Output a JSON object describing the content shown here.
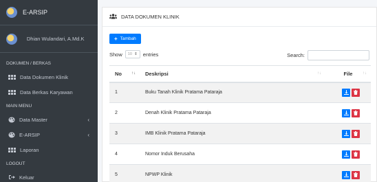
{
  "brand": {
    "title": "E-ARSIP"
  },
  "user": {
    "name": "Dhian Wulandari, A.Md.K"
  },
  "sidebar": {
    "sections": [
      {
        "header": "DOKUMEN / BERKAS"
      },
      {
        "header": "MAIN MENU"
      },
      {
        "header": "LOGOUT"
      }
    ],
    "items": [
      {
        "label": "Data Dokumen Klinik",
        "icon": "table-icon"
      },
      {
        "label": "Data Berkas Karyawan",
        "icon": "table-icon"
      },
      {
        "label": "Data Master",
        "icon": "palette-icon"
      },
      {
        "label": "E-ARSIP",
        "icon": "palette-icon"
      },
      {
        "label": "Laporan",
        "icon": "table-icon"
      },
      {
        "label": "Keluar",
        "icon": "sign-out-icon"
      }
    ]
  },
  "card": {
    "title": "DATA DOKUMEN KLINIK",
    "add_label": "Tambah"
  },
  "controls": {
    "show_label": "Show",
    "show_value": "10",
    "entries_label": "entries",
    "search_label": "Search:"
  },
  "table": {
    "headers": [
      "No",
      "Deskripsi",
      "File"
    ],
    "rows": [
      {
        "no": "1",
        "desc": "Buku Tanah Klinik Pratama Pataraja"
      },
      {
        "no": "2",
        "desc": "Denah Klinik Pratama Pataraja"
      },
      {
        "no": "3",
        "desc": "IMB Klinik Pratama Pataraja"
      },
      {
        "no": "4",
        "desc": "Nomor Induk Berusaha"
      },
      {
        "no": "5",
        "desc": "NPWP Klinik"
      }
    ]
  },
  "colors": {
    "sidebar": "#343a40",
    "primary": "#007bff",
    "danger": "#dc3545"
  }
}
